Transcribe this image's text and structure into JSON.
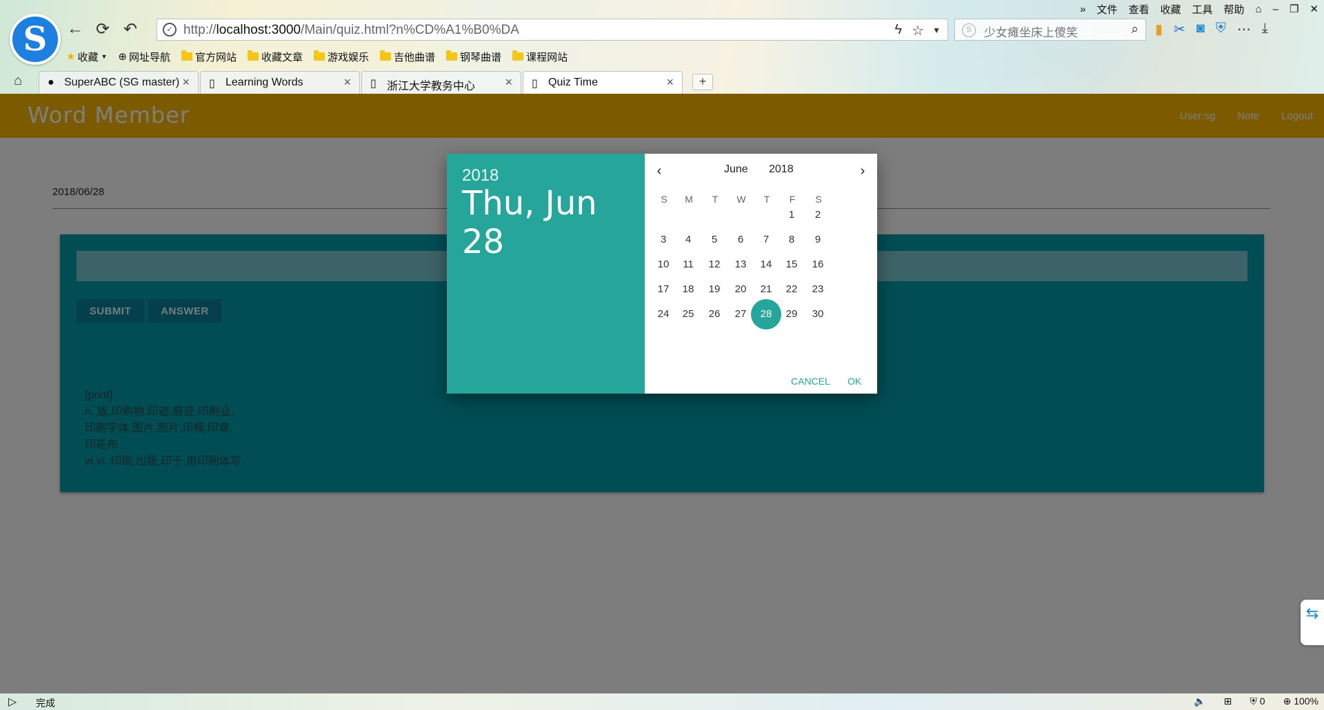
{
  "browser": {
    "menu": [
      "文件",
      "查看",
      "收藏",
      "工具",
      "帮助"
    ],
    "url_prefix": "http://",
    "url_host": "localhost:3000",
    "url_path": "/Main/quiz.html?n%CD%A1%B0%DA",
    "search_placeholder": "少女瘫坐床上傻笑",
    "bookmarks": [
      {
        "label": "收藏",
        "icon": "star-icon"
      },
      {
        "label": "网址导航",
        "icon": "globe-icon"
      },
      {
        "label": "官方网站",
        "icon": "folder-icon"
      },
      {
        "label": "收藏文章",
        "icon": "folder-icon"
      },
      {
        "label": "游戏娱乐",
        "icon": "folder-icon"
      },
      {
        "label": "吉他曲谱",
        "icon": "folder-icon"
      },
      {
        "label": "钢琴曲谱",
        "icon": "folder-icon"
      },
      {
        "label": "课程网站",
        "icon": "folder-icon"
      }
    ],
    "tabs": [
      {
        "label": "SuperABC (SG master)",
        "icon": "github-icon"
      },
      {
        "label": "Learning Words",
        "icon": "page-icon"
      },
      {
        "label": "浙江大学教务中心",
        "icon": "page-icon"
      },
      {
        "label": "Quiz Time",
        "icon": "page-icon",
        "active": true
      }
    ],
    "new_tab_label": "+",
    "status_text": "完成",
    "status_count": "0",
    "zoom": "100%"
  },
  "app": {
    "brand": "Word Member",
    "nav": {
      "user": "User:sg",
      "note": "Note",
      "logout": "Logout"
    },
    "date_value": "2018/06/28",
    "buttons": {
      "submit": "SUBMIT",
      "answer": "ANSWER"
    },
    "meaning_lines": [
      "[print]",
      "n. 版,印刷物,印迹,痕迹,印刷业,",
      "印刷字体,图片,照片,印模,印章,",
      "印花布",
      "vt.vi. 印刷,出版,印于,用印刷体写"
    ],
    "colors": {
      "appbar": "#f7b400",
      "card": "#009aa8",
      "accent": "#26a69a"
    }
  },
  "datepicker": {
    "year": "2018",
    "date_label": "Thu, Jun 28",
    "month": "June",
    "month_year": "2018",
    "weekdays": [
      "S",
      "M",
      "T",
      "W",
      "T",
      "F",
      "S"
    ],
    "first_weekday_index": 5,
    "days_in_month": 30,
    "selected_day": 28,
    "cancel": "CANCEL",
    "ok": "OK"
  }
}
